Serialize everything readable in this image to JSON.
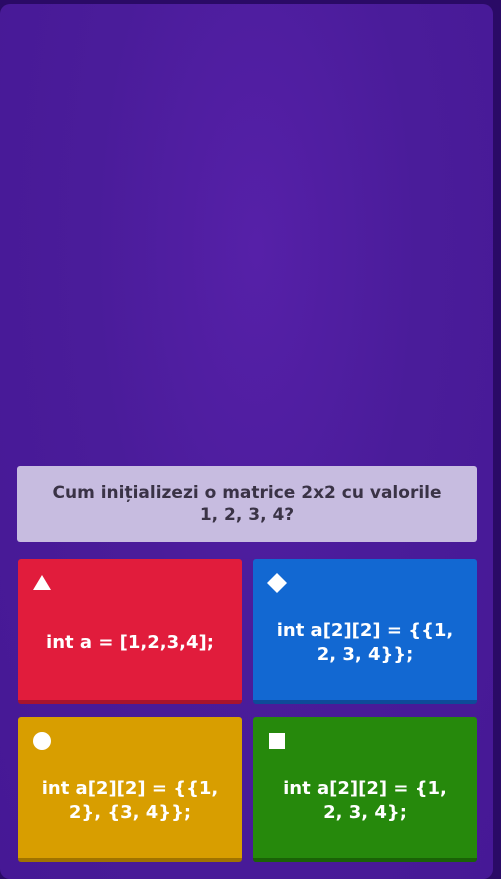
{
  "question": {
    "text": "Cum inițializezi o matrice 2x2 cu valorile 1, 2, 3, 4?"
  },
  "answers": [
    {
      "shape": "triangle-icon",
      "color": "#e11c3c",
      "text": "int a = [1,2,3,4];"
    },
    {
      "shape": "diamond-icon",
      "color": "#1268d2",
      "text": "int a[2][2] = {{1, 2, 3, 4}};"
    },
    {
      "shape": "circle-icon",
      "color": "#d89e00",
      "text": "int a[2][2] = {{1, 2}, {3, 4}};"
    },
    {
      "shape": "square-icon",
      "color": "#26890c",
      "text": "int a[2][2] = {1, 2, 3, 4};"
    }
  ]
}
